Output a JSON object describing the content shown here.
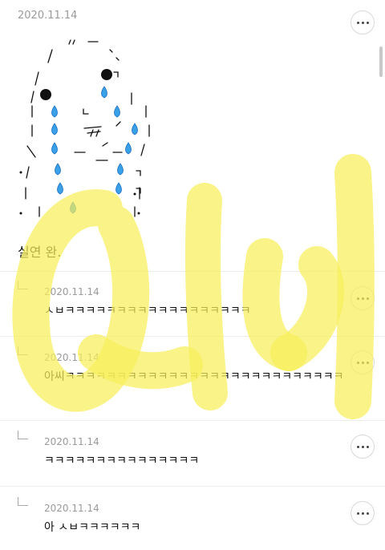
{
  "post": {
    "date": "2020.11.14",
    "body": "실연 완."
  },
  "comments": [
    {
      "date": "2020.11.14",
      "text": "ㅅㅂㅋㅋㅋㅋㅋㅋㅋㅋㅋㅋㅋㅋㅋㅋㅋㅋㅋㅋ"
    },
    {
      "date": "2020.11.14",
      "text": "아씨ㅋㅋㅋㅋㅋㅋㅋㅋㅋㅋㅋㅋㅋㅋㅋㅋㅋㅋㅋㅋㅋㅋㅋㅋㅋㅋㅋ"
    },
    {
      "date": "2020.11.14",
      "text": "ㅋㅋㅋㅋㅋㅋㅋㅋㅋㅋㅋㅋㅋㅋㅋ"
    },
    {
      "date": "2020.11.14",
      "text": "아 ㅅㅂㅋㅋㅋㅋㅋㅋ"
    }
  ],
  "colors": {
    "watermark": "#f7ee5a",
    "teardrop": "#3aa0e8"
  },
  "icons": {
    "more": "more-horizontal-icon",
    "reply": "reply-arrow-icon",
    "tear": "teardrop-icon"
  }
}
